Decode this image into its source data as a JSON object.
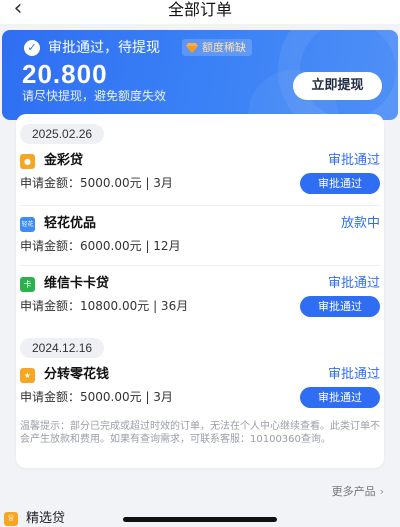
{
  "nav": {
    "title": "全部订单"
  },
  "banner": {
    "status": "审批通过，待提现",
    "tag": "额度稀缺",
    "amount": "20.800",
    "hint": "请尽快提现，避免额度失效",
    "withdraw_label": "立即提现",
    "colors": {
      "start": "#2f6ef2",
      "end": "#4f8ff7"
    }
  },
  "groups": [
    {
      "date": "2025.02.26",
      "orders": [
        {
          "name": "金彩贷",
          "status": "审批通过",
          "amount": "申请金额：5000.00元 | 3月",
          "button": "审批通过",
          "icon": "jincai-logo-icon",
          "icon_color": "#f5a623"
        },
        {
          "name": "轻花优品",
          "status": "放款中",
          "amount": "申请金额：6000.00元 | 12月",
          "button": "",
          "icon": "qinghua-logo-icon",
          "icon_color": "#3b8df5"
        },
        {
          "name": "维信卡卡贷",
          "status": "审批通过",
          "amount": "申请金额：10800.00元 | 36月",
          "button": "审批通过",
          "icon": "weixin-kaka-logo-icon",
          "icon_color": "#2bb24c"
        }
      ]
    },
    {
      "date": "2024.12.16",
      "orders": [
        {
          "name": "分转零花钱",
          "status": "审批通过",
          "amount": "申请金额：5000.00元 | 3月",
          "button": "审批通过",
          "icon": "fenzhuan-logo-icon",
          "icon_color": "#f5a623"
        }
      ]
    }
  ],
  "notice": "温馨提示：部分已完成或超过时效的订单，无法在个人中心继续查看。此类订单不会产生放款和费用。如果有查询需求，可联系客服：10100360查询。",
  "footer": {
    "more": "更多产品",
    "featured": "精选贷"
  }
}
